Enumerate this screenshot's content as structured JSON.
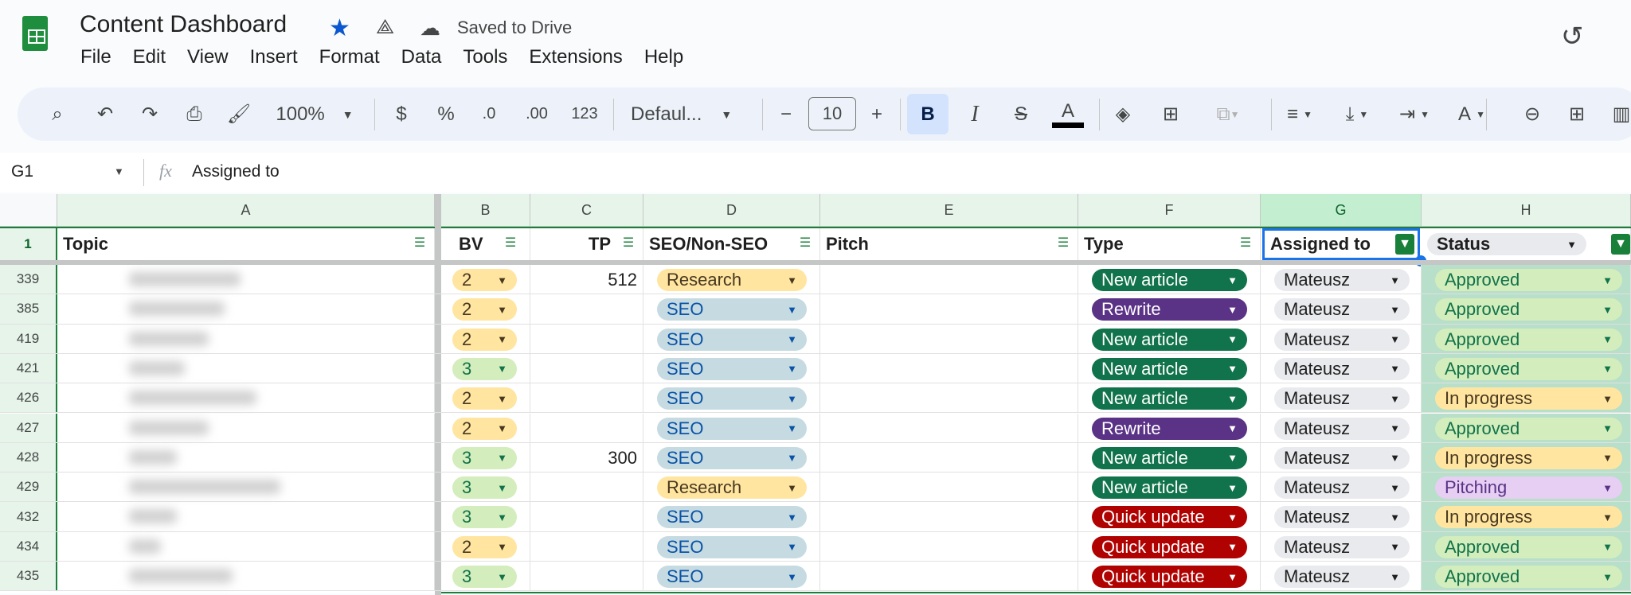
{
  "header": {
    "title": "Content Dashboard",
    "saved_status": "Saved to Drive",
    "icons": [
      "sheets-logo",
      "star-icon",
      "move-to-drive-icon",
      "cloud-saved-icon",
      "history-icon"
    ],
    "star_color": "#0b57d0"
  },
  "menu": [
    "File",
    "Edit",
    "View",
    "Insert",
    "Format",
    "Data",
    "Tools",
    "Extensions",
    "Help"
  ],
  "toolbar": {
    "zoom": "100%",
    "currency": "$",
    "percent": "%",
    "dec_decrease": ".0",
    "dec_increase": ".00",
    "number_format": "123",
    "font": "Defaul...",
    "font_size": "10",
    "minus": "−",
    "plus": "+",
    "bold": "B",
    "italic": "I",
    "text_color_label": "A",
    "rotate_label": "A"
  },
  "formula_bar": {
    "cell_ref": "G1",
    "fx": "fx",
    "content": "Assigned to"
  },
  "columns": [
    "A",
    "B",
    "C",
    "D",
    "E",
    "F",
    "G",
    "H"
  ],
  "header_row": {
    "row_number": "1",
    "cells": [
      "Topic",
      "BV",
      "TP",
      "SEO/Non-SEO",
      "Pitch",
      "Type",
      "Assigned to",
      "Status"
    ]
  },
  "colors": {
    "bv_2": "#ffe5a0",
    "bv_3": "#d4edbc",
    "research": "#ffe5a0",
    "seo": "#c6dbe1",
    "new_article": "#11734b",
    "rewrite": "#5a3286",
    "quick_update": "#b10202",
    "assignee": "#e8eaed",
    "approved": "#d4edbc",
    "in_progress": "#ffe5a0",
    "pitching": "#e6cff2"
  },
  "rows": [
    {
      "n": "339",
      "bv": "2",
      "tp": "512",
      "seo": "Research",
      "type": "New article",
      "assigned": "Mateusz",
      "status": "Approved"
    },
    {
      "n": "385",
      "bv": "2",
      "tp": "",
      "seo": "SEO",
      "type": "Rewrite",
      "assigned": "Mateusz",
      "status": "Approved"
    },
    {
      "n": "419",
      "bv": "2",
      "tp": "",
      "seo": "SEO",
      "type": "New article",
      "assigned": "Mateusz",
      "status": "Approved"
    },
    {
      "n": "421",
      "bv": "3",
      "tp": "",
      "seo": "SEO",
      "type": "New article",
      "assigned": "Mateusz",
      "status": "Approved"
    },
    {
      "n": "426",
      "bv": "2",
      "tp": "",
      "seo": "SEO",
      "type": "New article",
      "assigned": "Mateusz",
      "status": "In progress"
    },
    {
      "n": "427",
      "bv": "2",
      "tp": "",
      "seo": "SEO",
      "type": "Rewrite",
      "assigned": "Mateusz",
      "status": "Approved"
    },
    {
      "n": "428",
      "bv": "3",
      "tp": "300",
      "seo": "SEO",
      "type": "New article",
      "assigned": "Mateusz",
      "status": "In progress"
    },
    {
      "n": "429",
      "bv": "3",
      "tp": "",
      "seo": "Research",
      "type": "New article",
      "assigned": "Mateusz",
      "status": "Pitching"
    },
    {
      "n": "432",
      "bv": "3",
      "tp": "",
      "seo": "SEO",
      "type": "Quick update",
      "assigned": "Mateusz",
      "status": "In progress"
    },
    {
      "n": "434",
      "bv": "2",
      "tp": "",
      "seo": "SEO",
      "type": "Quick update",
      "assigned": "Mateusz",
      "status": "Approved"
    },
    {
      "n": "435",
      "bv": "3",
      "tp": "",
      "seo": "SEO",
      "type": "Quick update",
      "assigned": "Mateusz",
      "status": "Approved"
    }
  ]
}
